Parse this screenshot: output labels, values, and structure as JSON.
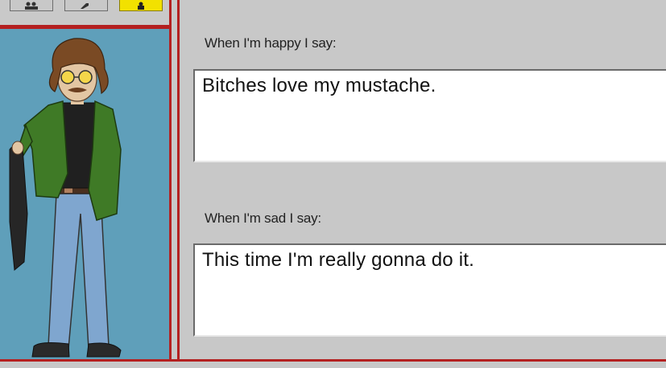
{
  "toolbar": {
    "buttons": [
      {
        "icon": "people-icon"
      },
      {
        "icon": "tools-icon"
      },
      {
        "icon": "figure-icon",
        "active": true
      }
    ]
  },
  "portrait": {
    "description_icon": "character-portrait"
  },
  "happy": {
    "label": "When I'm happy I say:",
    "value": "Bitches love my mustache."
  },
  "sad": {
    "label": "When I'm sad I say:",
    "value": "This time I'm really gonna do it."
  },
  "colors": {
    "frame_red": "#b42020",
    "panel_blue": "#5f9fba",
    "ui_gray": "#c8c8c8",
    "active_yellow": "#f2e100"
  }
}
